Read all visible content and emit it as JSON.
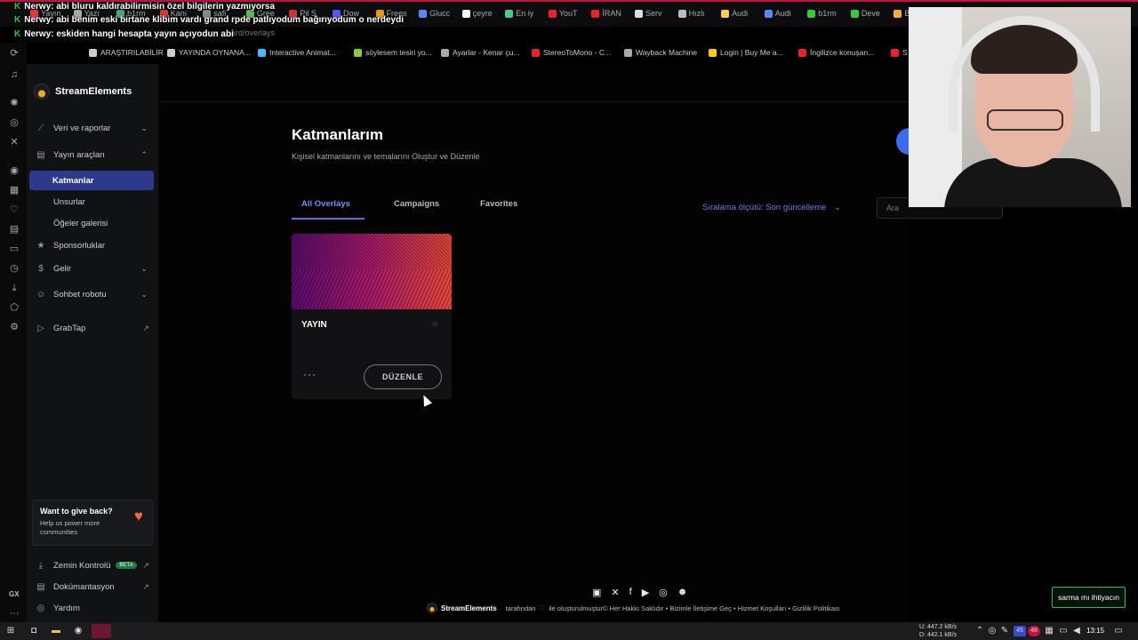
{
  "browser": {
    "tabs": [
      "Yayın",
      "Yazı",
      "b1rm",
      "Kanı",
      "safi",
      "Gree",
      "Pil S",
      "Dow",
      "Frees",
      "Glucc",
      "çeyre",
      "En iy",
      "YouT",
      "İRAN",
      "Serv",
      "Hızlı",
      "Audi",
      "Audi",
      "b1rm",
      "Deve",
      "Ba"
    ],
    "url": "ard/overlays",
    "bookmarks": [
      "ARAŞTIRILABİLİR",
      "YAYINDA OYNANA...",
      "Interactive Animat...",
      "söylesem tesiri yo...",
      "Ayarlar - Kenar çu...",
      "StereoToMono - C...",
      "Wayback Machine",
      "Login | Buy Me a...",
      "İngilizce konuşan...",
      "S"
    ]
  },
  "chat": [
    {
      "user": "Nerwy:",
      "message": "abi bluru kaldırabilirmisin özel bilgilerin yazmıyorsa"
    },
    {
      "user": "Nerwy:",
      "message": "abi benim eski birtane klibim vardı grand rpde patlıyodum bağırıyodum o nerdeydi"
    },
    {
      "user": "Nerwy:",
      "message": "eskiden hangi hesapta yayın açıyodun abi"
    }
  ],
  "sidebar": {
    "brand": "StreamElements",
    "items": [
      {
        "label": "Veri ve raporlar",
        "icon": "chart-icon",
        "chevron": "⌄"
      },
      {
        "label": "Yayın araçları",
        "icon": "tools-icon",
        "chevron": "⌃"
      },
      {
        "label": "Katmanlar",
        "active": true
      },
      {
        "label": "Unsurlar"
      },
      {
        "label": "Öğeler galerisi"
      },
      {
        "label": "Sponsorluklar",
        "icon": "star-icon"
      },
      {
        "label": "Gelir",
        "icon": "dollar-icon",
        "chevron": "⌄"
      },
      {
        "label": "Sohbet robotu",
        "icon": "bot-icon",
        "chevron": "⌄"
      },
      {
        "label": "GrabTap",
        "icon": "grabtap-icon"
      }
    ],
    "give_back": {
      "title": "Want to give back?",
      "text": "Help us power more communities"
    },
    "bottom": [
      {
        "label": "Zemin Kontrolü",
        "badge": "BETA"
      },
      {
        "label": "Dokümantasyon"
      },
      {
        "label": "Yardım"
      }
    ]
  },
  "main": {
    "title": "Katmanlarım",
    "subtitle": "Kişisel katmanlarını ve temalarını Oluştur ve Düzenle",
    "tabs": [
      "All Overlays",
      "Campaigns",
      "Favorites"
    ],
    "sort_label": "Sıralama ölçütü: Son güncelleme",
    "search_placeholder": "Ara",
    "overlay_card": {
      "name": "YAYIN",
      "edit_label": "DÜZENLE",
      "more": "···"
    }
  },
  "footer": {
    "brand": "StreamElements",
    "text1": "tarafından",
    "text2": "ile oluşturulmuştur© Her Hakkı Saklıdır • Bizimle İletişime Geç • Hizmet Koşulları • Gizlilik Politikası"
  },
  "overlay_button": "sarma mı ihtiyacın",
  "taskbar": {
    "net_up": "447.2 kB/s",
    "net_down": "442.1 kB/s",
    "net_up_label": "U:",
    "net_down_label": "D:",
    "clock": "13:15",
    "badge1": "45",
    "badge2": "48",
    "gx": "GX"
  },
  "colors": {
    "accent": "#5a6fe6",
    "active_nav": "#2d3a8c",
    "chat_green": "#2ecc40"
  }
}
